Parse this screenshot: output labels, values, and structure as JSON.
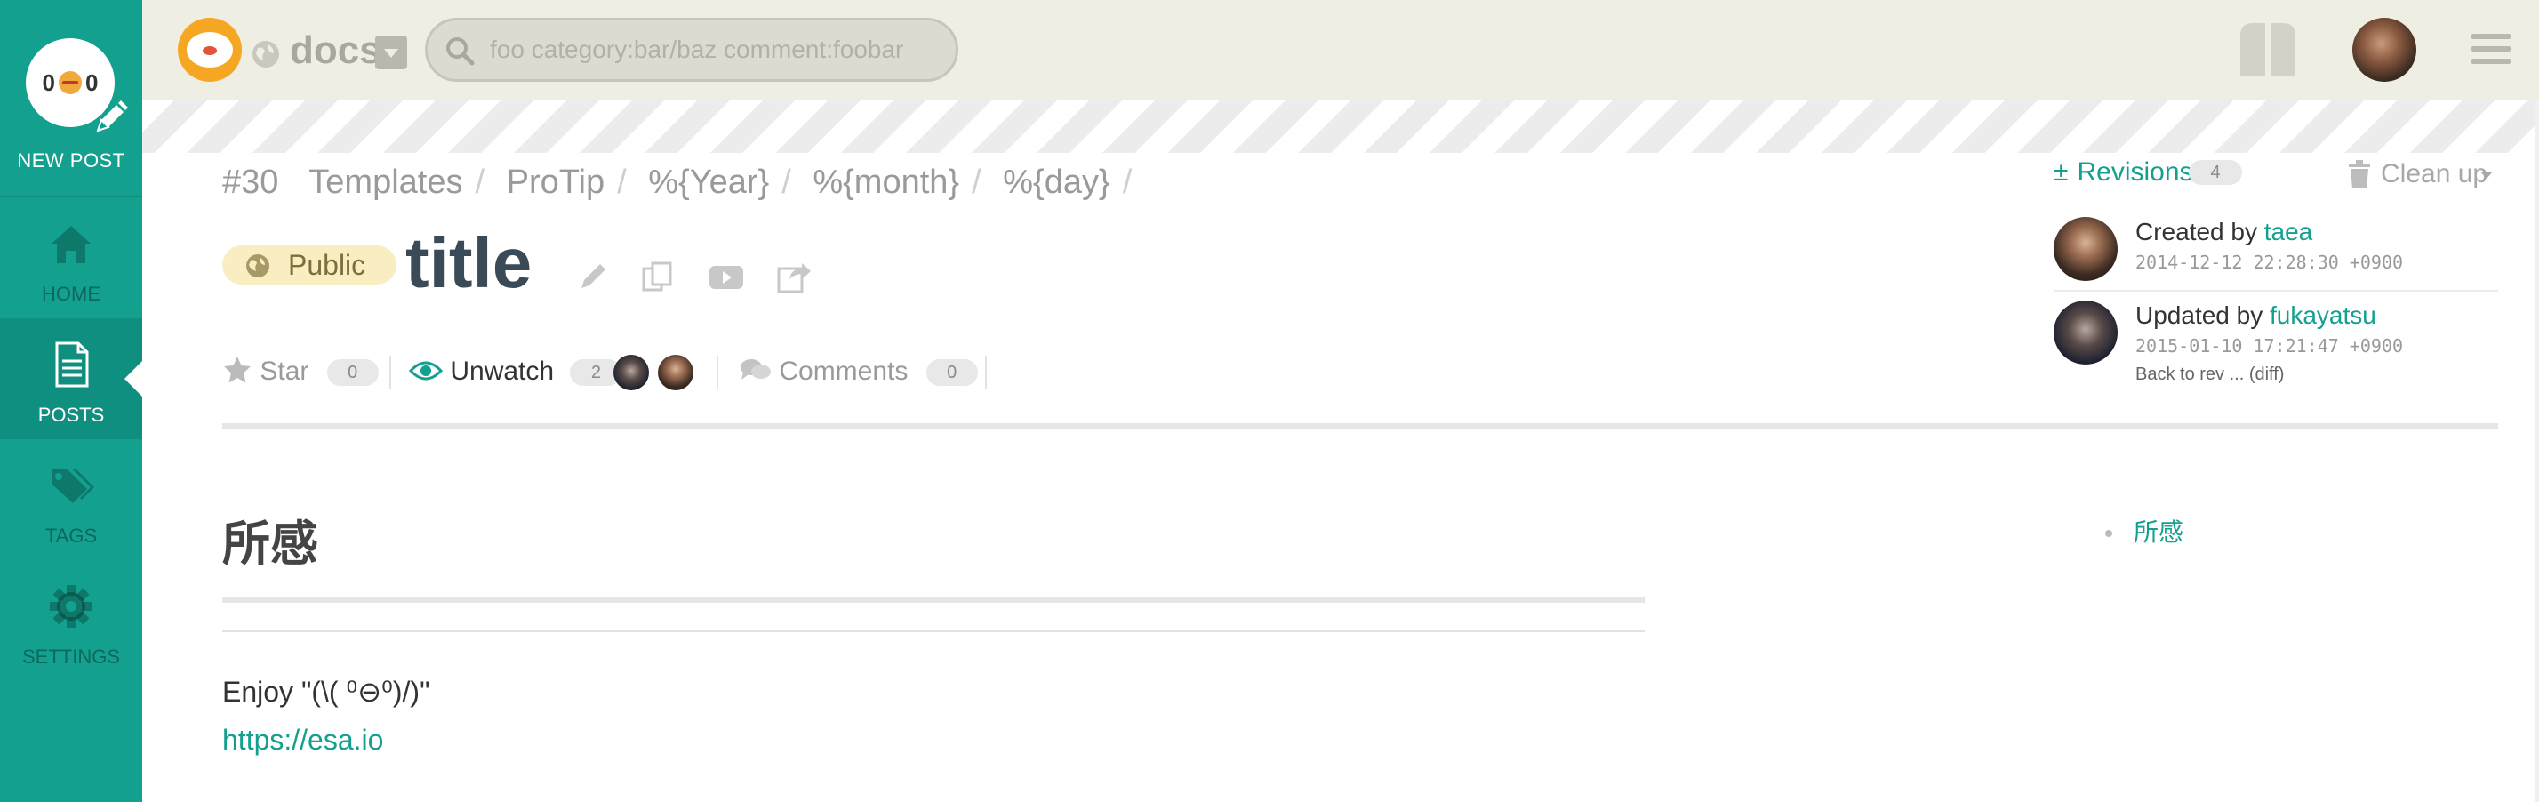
{
  "sidebar": {
    "new_post": {
      "label": "NEW POST",
      "face_left": "0",
      "face_right": "0"
    },
    "items": [
      {
        "id": "home",
        "label": "HOME",
        "icon": "home-icon"
      },
      {
        "id": "posts",
        "label": "POSTS",
        "icon": "document-icon",
        "active": true
      },
      {
        "id": "tags",
        "label": "TAGS",
        "icon": "tags-icon"
      },
      {
        "id": "settings",
        "label": "SETTINGS",
        "icon": "gear-icon"
      }
    ]
  },
  "header": {
    "team_name": "docs",
    "search_placeholder": "foo category:bar/baz comment:foobar"
  },
  "breadcrumb": {
    "number": "#30",
    "items": [
      "Templates",
      "ProTip",
      "%{Year}",
      "%{month}",
      "%{day}"
    ],
    "separator": "/"
  },
  "post": {
    "visibility": "Public",
    "title": "title"
  },
  "meta": {
    "star_label": "Star",
    "star_count": "0",
    "watch_label": "Unwatch",
    "watch_count": "2",
    "comments_label": "Comments",
    "comments_count": "0"
  },
  "content": {
    "heading": "所感",
    "text": "Enjoy \"(\\( ⁰⊖⁰)/)\"",
    "link": "https://esa.io"
  },
  "toc": {
    "items": [
      "所感"
    ]
  },
  "revisions": {
    "label": "Revisions",
    "count": "4",
    "cleanup_label": "Clean up",
    "created_prefix": "Created by",
    "created_user": "taea",
    "created_at": "2014-12-12 22:28:30 +0900",
    "updated_prefix": "Updated by",
    "updated_user": "fukayatsu",
    "updated_at": "2015-01-10 17:21:47 +0900",
    "back_to_rev": "Back to rev ... (diff)"
  },
  "colors": {
    "brand": "#13a08e",
    "header_bg": "#efeee3",
    "public_badge": "#f9eec1"
  }
}
